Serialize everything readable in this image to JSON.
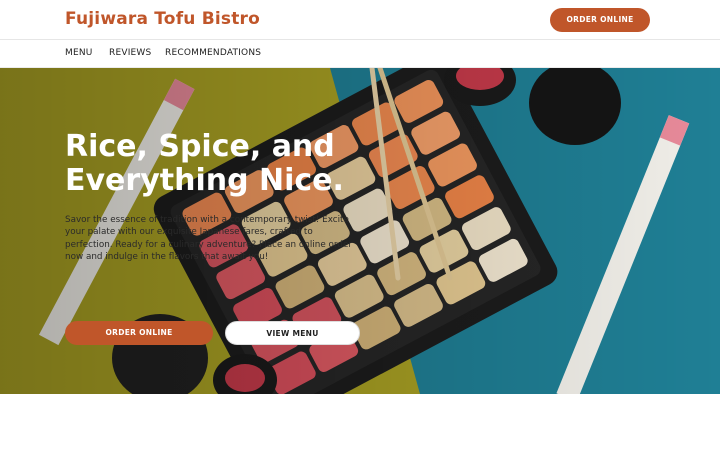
{
  "header": {
    "brand": "Fujiwara Tofu Bistro",
    "order_button": "ORDER ONLINE"
  },
  "nav": {
    "items": [
      {
        "label": "MENU"
      },
      {
        "label": "REVIEWS"
      },
      {
        "label": "RECOMMENDATIONS"
      }
    ]
  },
  "hero": {
    "title": "Rice, Spice, and Everything Nice.",
    "text": "Savor the essence of tradition with a contemporary twist! Excite your palate with our exquisite Japanese fares, crafted to perfection. Ready for a culinary adventure? Place an online order now and indulge in the flavors that await you!",
    "order_button": "ORDER ONLINE",
    "menu_button": "VIEW MENU"
  },
  "colors": {
    "accent": "#c0562a",
    "hero_left": "#a8a023",
    "hero_right": "#1f7f95"
  }
}
